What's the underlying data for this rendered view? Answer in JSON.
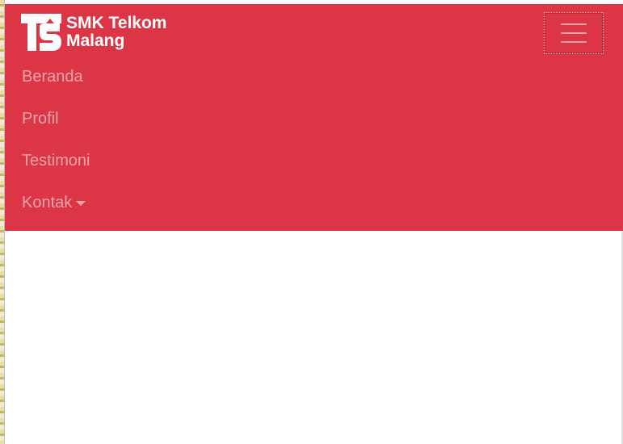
{
  "brand": {
    "line1": "SMK Telkom",
    "line2": "Malang",
    "logo_icon": "ts-logo-icon"
  },
  "toggler": {
    "icon": "hamburger-icon"
  },
  "nav": {
    "items": [
      {
        "label": "Beranda"
      },
      {
        "label": "Profil"
      },
      {
        "label": "Testimoni"
      },
      {
        "label": "Kontak",
        "icon": "caret-down-icon"
      }
    ]
  },
  "colors": {
    "navbar_bg": "#dc3545",
    "link": "rgba(255,255,255,0.55)",
    "brand_text": "#ffffff"
  }
}
